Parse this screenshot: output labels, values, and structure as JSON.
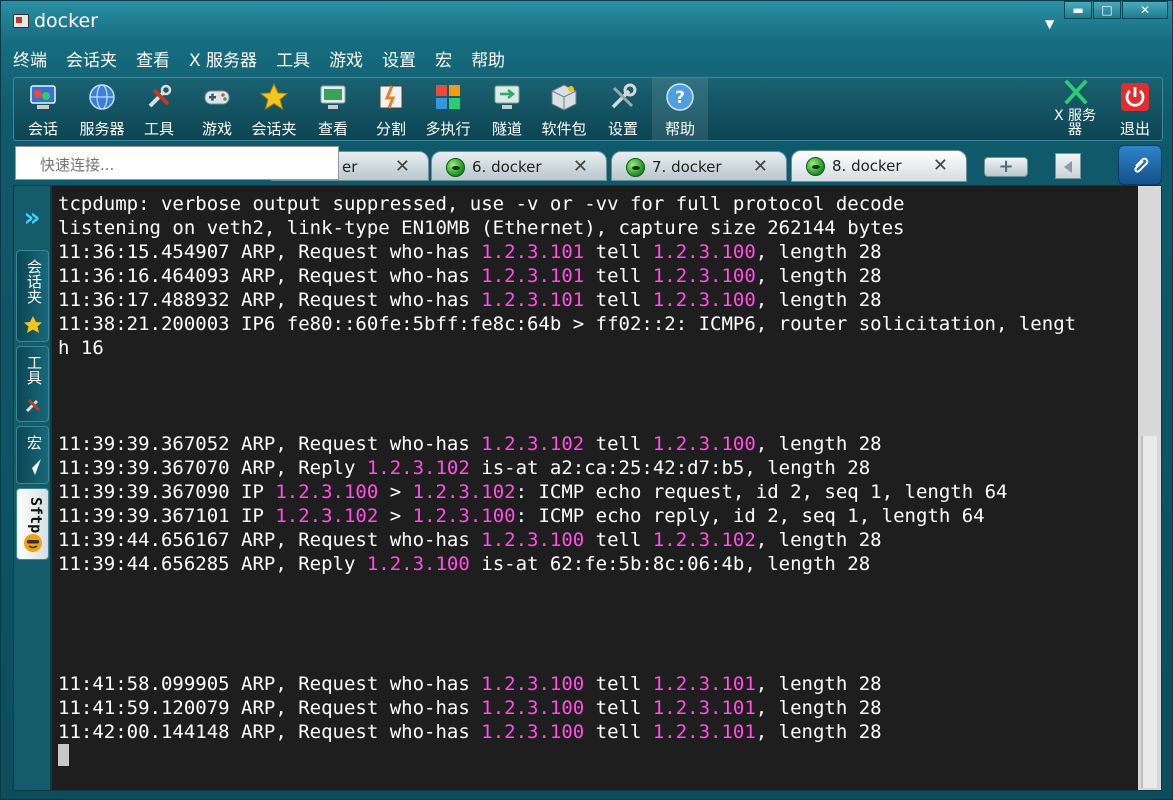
{
  "window": {
    "title": "docker"
  },
  "menu": [
    "终端",
    "会话夹",
    "查看",
    "X 服务器",
    "工具",
    "游戏",
    "设置",
    "宏",
    "帮助"
  ],
  "toolbar": {
    "buttons": [
      "会话",
      "服务器",
      "工具",
      "游戏",
      "会话夹",
      "查看",
      "分割",
      "多执行",
      "隧道",
      "软件包",
      "设置",
      "帮助"
    ],
    "xserver": "X 服务器",
    "exit": "退出"
  },
  "quick_connect": {
    "placeholder": "快速连接..."
  },
  "tabs": [
    {
      "title": "er",
      "active": false
    },
    {
      "title": "6. docker",
      "active": false
    },
    {
      "title": "7. docker",
      "active": false
    },
    {
      "title": "8. docker",
      "active": true
    }
  ],
  "tab_close_glyph": "✕",
  "sidebar": {
    "expand_glyph": "»",
    "tabs": [
      "会话夹",
      "工具",
      "宏",
      "Sftp"
    ],
    "active": "Sftp"
  },
  "colors": {
    "highlight": "#ff4fe5",
    "terminal_bg": "#1e1e1e",
    "chrome": "#176d80"
  },
  "terminal": {
    "lines": [
      [
        {
          "t": "tcpdump: verbose output suppressed, use -v or -vv for full protocol decode"
        }
      ],
      [
        {
          "t": "listening on veth2, link-type EN10MB (Ethernet), capture size 262144 bytes"
        }
      ],
      [
        {
          "t": "11:36:15.454907 ARP, Request who-has "
        },
        {
          "t": "1.2.3.101",
          "hl": true
        },
        {
          "t": " tell "
        },
        {
          "t": "1.2.3.100",
          "hl": true
        },
        {
          "t": ", length 28"
        }
      ],
      [
        {
          "t": "11:36:16.464093 ARP, Request who-has "
        },
        {
          "t": "1.2.3.101",
          "hl": true
        },
        {
          "t": " tell "
        },
        {
          "t": "1.2.3.100",
          "hl": true
        },
        {
          "t": ", length 28"
        }
      ],
      [
        {
          "t": "11:36:17.488932 ARP, Request who-has "
        },
        {
          "t": "1.2.3.101",
          "hl": true
        },
        {
          "t": " tell "
        },
        {
          "t": "1.2.3.100",
          "hl": true
        },
        {
          "t": ", length 28"
        }
      ],
      [
        {
          "t": "11:38:21.200003 IP6 fe80::60fe:5bff:fe8c:64b > ff02::2: ICMP6, router solicitation, lengt"
        }
      ],
      [
        {
          "t": "h 16"
        }
      ],
      [],
      [],
      [],
      [
        {
          "t": "11:39:39.367052 ARP, Request who-has "
        },
        {
          "t": "1.2.3.102",
          "hl": true
        },
        {
          "t": " tell "
        },
        {
          "t": "1.2.3.100",
          "hl": true
        },
        {
          "t": ", length 28"
        }
      ],
      [
        {
          "t": "11:39:39.367070 ARP, Reply "
        },
        {
          "t": "1.2.3.102",
          "hl": true
        },
        {
          "t": " is-at a2:ca:25:42:d7:b5, length 28"
        }
      ],
      [
        {
          "t": "11:39:39.367090 IP "
        },
        {
          "t": "1.2.3.100",
          "hl": true
        },
        {
          "t": " > "
        },
        {
          "t": "1.2.3.102",
          "hl": true
        },
        {
          "t": ": ICMP echo request, id 2, seq 1, length 64"
        }
      ],
      [
        {
          "t": "11:39:39.367101 IP "
        },
        {
          "t": "1.2.3.102",
          "hl": true
        },
        {
          "t": " > "
        },
        {
          "t": "1.2.3.100",
          "hl": true
        },
        {
          "t": ": ICMP echo reply, id 2, seq 1, length 64"
        }
      ],
      [
        {
          "t": "11:39:44.656167 ARP, Request who-has "
        },
        {
          "t": "1.2.3.100",
          "hl": true
        },
        {
          "t": " tell "
        },
        {
          "t": "1.2.3.102",
          "hl": true
        },
        {
          "t": ", length 28"
        }
      ],
      [
        {
          "t": "11:39:44.656285 ARP, Reply "
        },
        {
          "t": "1.2.3.100",
          "hl": true
        },
        {
          "t": " is-at 62:fe:5b:8c:06:4b, length 28"
        }
      ],
      [],
      [],
      [],
      [],
      [
        {
          "t": "11:41:58.099905 ARP, Request who-has "
        },
        {
          "t": "1.2.3.100",
          "hl": true
        },
        {
          "t": " tell "
        },
        {
          "t": "1.2.3.101",
          "hl": true
        },
        {
          "t": ", length 28"
        }
      ],
      [
        {
          "t": "11:41:59.120079 ARP, Request who-has "
        },
        {
          "t": "1.2.3.100",
          "hl": true
        },
        {
          "t": " tell "
        },
        {
          "t": "1.2.3.101",
          "hl": true
        },
        {
          "t": ", length 28"
        }
      ],
      [
        {
          "t": "11:42:00.144148 ARP, Request who-has "
        },
        {
          "t": "1.2.3.100",
          "hl": true
        },
        {
          "t": " tell "
        },
        {
          "t": "1.2.3.101",
          "hl": true
        },
        {
          "t": ", length 28"
        }
      ]
    ]
  }
}
